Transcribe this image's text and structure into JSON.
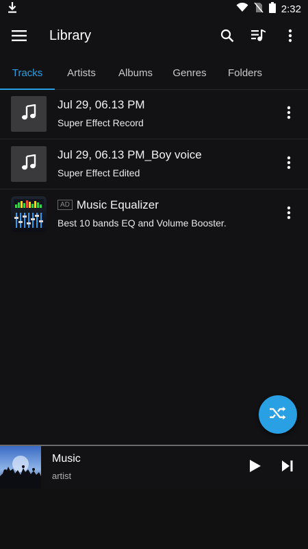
{
  "status_bar": {
    "time": "2:32",
    "icons": [
      "download-icon",
      "wifi-icon",
      "no-sim-icon",
      "battery-icon"
    ]
  },
  "app_bar": {
    "title": "Library",
    "icons": [
      "menu-icon",
      "search-icon",
      "queue-music-icon",
      "more-vert-icon"
    ]
  },
  "tabs": [
    {
      "label": "Tracks",
      "active": true
    },
    {
      "label": "Artists",
      "active": false
    },
    {
      "label": "Albums",
      "active": false
    },
    {
      "label": "Genres",
      "active": false
    },
    {
      "label": "Folders",
      "active": false
    }
  ],
  "tracks": [
    {
      "title": "Jul 29, 06.13 PM",
      "subtitle": "Super Effect Record",
      "icon": "music-note-icon"
    },
    {
      "title": "Jul 29, 06.13 PM_Boy voice",
      "subtitle": "Super Effect Edited",
      "icon": "music-note-icon"
    }
  ],
  "ad": {
    "badge": "AD",
    "title": "Music Equalizer",
    "subtitle": "Best 10 bands EQ and Volume Booster.",
    "icon": "equalizer-app-icon"
  },
  "fab": {
    "icon": "shuffle-icon"
  },
  "mini_player": {
    "title": "Music",
    "artist": "artist",
    "icons": [
      "play-icon",
      "skip-next-icon"
    ]
  },
  "colors": {
    "accent": "#29a0e3",
    "background": "#121214",
    "divider": "#26262a"
  }
}
